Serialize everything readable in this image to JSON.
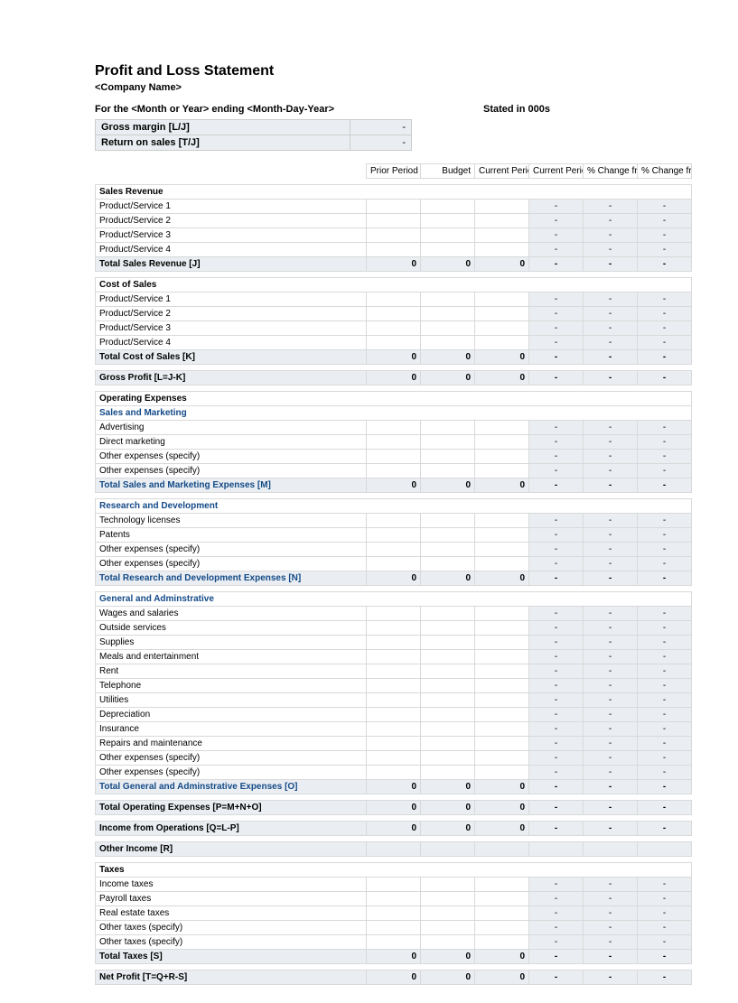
{
  "title": "Profit and Loss Statement",
  "company_name": "<Company Name>",
  "period_line": "For the <Month or Year> ending <Month-Day-Year>",
  "stated_in": "Stated in 000s",
  "ratios": {
    "gross_margin_label": "Gross margin  [L/J]",
    "gross_margin_value": "-",
    "return_on_sales_label": "Return on sales  [T/J]",
    "return_on_sales_value": "-"
  },
  "headers": {
    "prior_period": "Prior Period",
    "budget": "Budget",
    "current_period": "Current Period",
    "pct_sales": "Current Period as % of Sales",
    "pct_prior": "% Change from Prior Period",
    "pct_budget": "% Change from Budget"
  },
  "dash": "-",
  "zero": "0",
  "sales_revenue": {
    "title": "Sales Revenue",
    "rows": [
      "Product/Service 1",
      "Product/Service 2",
      "Product/Service 3",
      "Product/Service 4"
    ],
    "total_label": "Total Sales Revenue  [J]"
  },
  "cost_of_sales": {
    "title": "Cost of Sales",
    "rows": [
      "Product/Service 1",
      "Product/Service 2",
      "Product/Service 3",
      "Product/Service 4"
    ],
    "total_label": "Total Cost of Sales  [K]"
  },
  "gross_profit_label": "Gross Profit  [L=J-K]",
  "op_exp_title": "Operating Expenses",
  "sales_marketing": {
    "title": "Sales and Marketing",
    "rows": [
      "Advertising",
      "Direct marketing",
      "Other expenses (specify)",
      "Other expenses (specify)"
    ],
    "total_label": "Total Sales and Marketing Expenses  [M]"
  },
  "r_and_d": {
    "title": "Research and Development",
    "rows": [
      "Technology licenses",
      "Patents",
      "Other expenses (specify)",
      "Other expenses (specify)"
    ],
    "total_label": "Total Research and Development Expenses  [N]"
  },
  "g_and_a": {
    "title": "General and Adminstrative",
    "rows": [
      "Wages and salaries",
      "Outside services",
      "Supplies",
      "Meals and entertainment",
      "Rent",
      "Telephone",
      "Utilities",
      "Depreciation",
      "Insurance",
      "Repairs and maintenance",
      "Other expenses (specify)",
      "Other expenses (specify)"
    ],
    "total_label": "Total General and Adminstrative Expenses  [O]"
  },
  "total_op_exp_label": "Total Operating Expenses  [P=M+N+O]",
  "income_ops_label": "Income from Operations  [Q=L-P]",
  "other_income_label": "Other Income  [R]",
  "taxes": {
    "title": "Taxes",
    "rows": [
      "Income taxes",
      "Payroll taxes",
      "Real estate taxes",
      "Other taxes (specify)",
      "Other taxes (specify)"
    ],
    "total_label": "Total Taxes  [S]"
  },
  "net_profit_label": "Net Profit  [T=Q+R-S]"
}
